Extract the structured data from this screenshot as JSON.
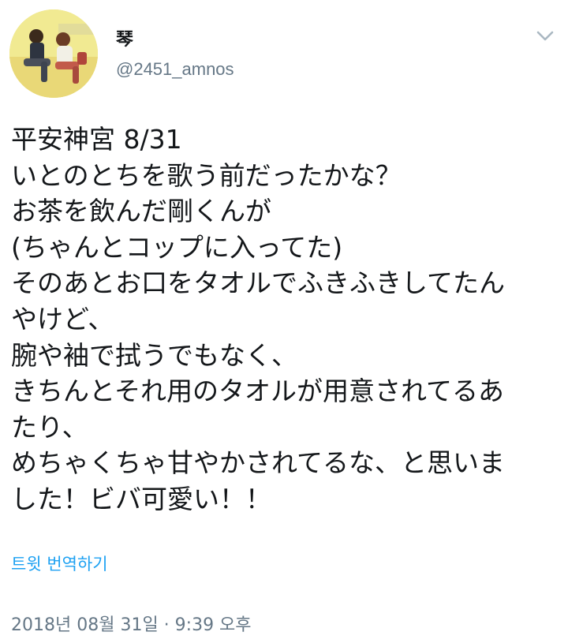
{
  "tweet": {
    "author": {
      "display_name": "琴",
      "handle": "@2451_amnos",
      "avatar_icon": "user-avatar-photo"
    },
    "menu_icon": "chevron-down-icon",
    "text_lines": [
      "平安神宮 8/31",
      "いとのとちを歌う前だったかな？",
      "お茶を飲んだ剛くんが",
      "(ちゃんとコップに入ってた)",
      "そのあとお口をタオルでふきふきしてたん",
      "やけど、",
      "腕や袖で拭うでもなく、",
      "きちんとそれ用のタオルが用意されてるあ",
      "たり、",
      "めちゃくちゃ甘やかされてるな、と思いま",
      "した！ビバ可愛い！！"
    ],
    "translate_label": "트윗 번역하기",
    "timestamp": "2018년 08월 31일 · 9:39 오후"
  },
  "colors": {
    "text": "#14171a",
    "secondary": "#657786",
    "link": "#1da1f2",
    "menu_chevron": "#aab8c2"
  }
}
